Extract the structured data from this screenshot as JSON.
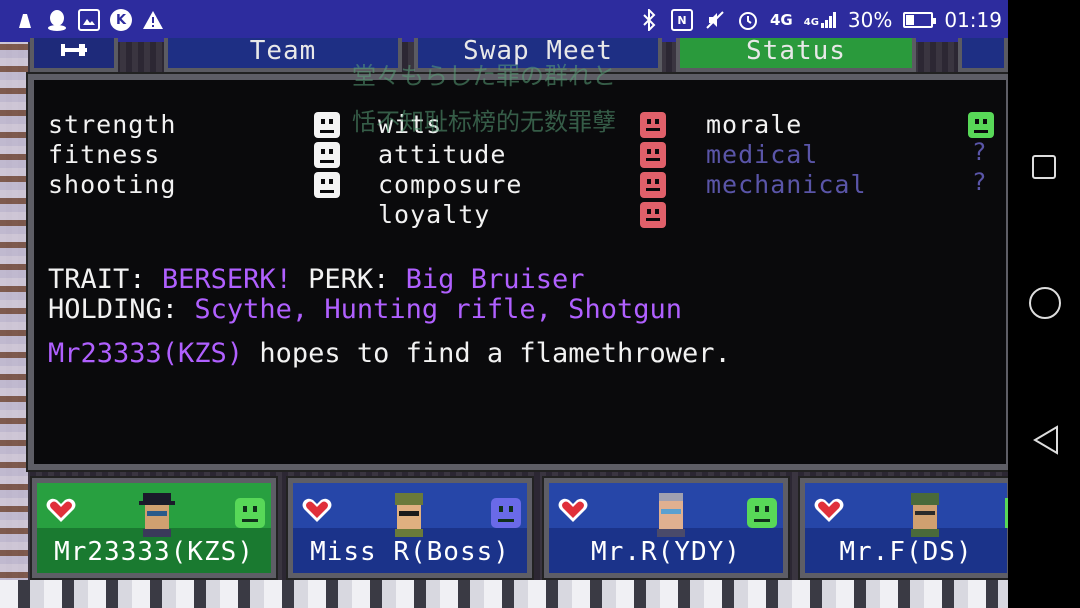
{
  "status_bar": {
    "left_icons": [
      "cleaner-icon",
      "qq-icon",
      "gallery-icon",
      "k-app-icon",
      "warning-icon"
    ],
    "right_icons": [
      "bluetooth-icon",
      "nfc-icon",
      "mute-icon",
      "alarm-icon"
    ],
    "network_label": "4G",
    "signal_label": "4G",
    "battery": "30%",
    "battery_level": 0.3,
    "time": "01:19"
  },
  "tabs": {
    "team": "Team",
    "swap": "Swap Meet",
    "status": "Status"
  },
  "watermark": {
    "line1": "堂々もらした罪の群れと",
    "line2": "恬不知耻标榜的无数罪孽"
  },
  "stats": {
    "col1": [
      {
        "label": "strength",
        "face": "white"
      },
      {
        "label": "fitness",
        "face": "white"
      },
      {
        "label": "shooting",
        "face": "white"
      }
    ],
    "col2": [
      {
        "label": "wits",
        "face": "red"
      },
      {
        "label": "attitude",
        "face": "red"
      },
      {
        "label": "composure",
        "face": "red"
      },
      {
        "label": "loyalty",
        "face": "red"
      }
    ],
    "col3": [
      {
        "label": "morale",
        "indicator": "green-face"
      },
      {
        "label": "medical",
        "indicator": "?"
      },
      {
        "label": "mechanical",
        "indicator": "?"
      }
    ]
  },
  "info": {
    "trait_label": "TRAIT:",
    "trait_value": "BERSERK!",
    "perk_label": "PERK:",
    "perk_value": "Big Bruiser",
    "holding_label": "HOLDING:",
    "holding_value": "Scythe, Hunting rifle, Shotgun",
    "hope_name": "Mr23333(KZS)",
    "hope_text": "hopes to find a flamethrower."
  },
  "party": [
    {
      "name": "Mr23333(KZS)",
      "mood": "green",
      "active": true
    },
    {
      "name": "Miss R(Boss)",
      "mood": "blue",
      "active": false
    },
    {
      "name": "Mr.R(YDY)",
      "mood": "green",
      "active": false
    },
    {
      "name": "Mr.F(DS)",
      "mood": "green",
      "active": false
    }
  ],
  "colors": {
    "status_bar": "#2d2c9e",
    "active_tab": "#2a9a3c",
    "accent_purple": "#b060ff",
    "dim_stat": "#5a55a8"
  }
}
